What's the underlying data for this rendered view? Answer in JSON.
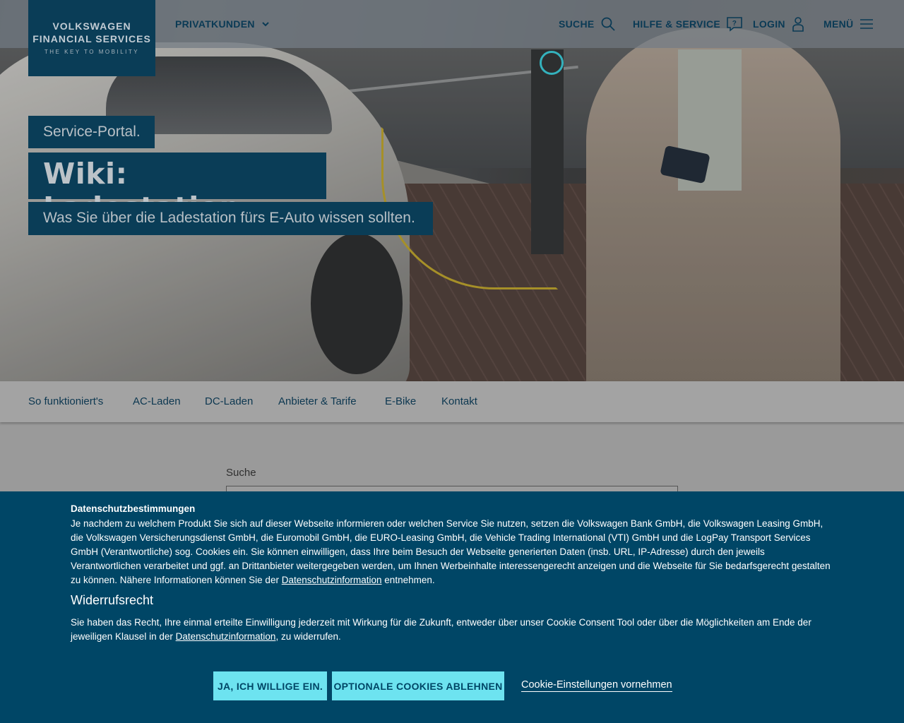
{
  "header": {
    "logo": {
      "line1": "VOLKSWAGEN",
      "line2": "FINANCIAL SERVICES",
      "tagline": "THE KEY TO MOBILITY"
    },
    "segment_label": "PRIVATKUNDEN",
    "search_label": "SUCHE",
    "help_label": "HILFE & SERVICE",
    "login_label": "LOGIN",
    "menu_label": "MENÜ"
  },
  "hero": {
    "kicker": "Service-Portal.",
    "title": "Wiki: Ladestation.",
    "subtitle": "Was Sie über die Ladestation fürs E-Auto wissen sollten."
  },
  "tabs": [
    {
      "label": "So funktioniert's"
    },
    {
      "label": "AC-Laden"
    },
    {
      "label": "DC-Laden"
    },
    {
      "label": "Anbieter & Tarife"
    },
    {
      "label": "E-Bike"
    },
    {
      "label": "Kontakt"
    }
  ],
  "content": {
    "search_label": "Suche",
    "search_value": ""
  },
  "cookie_banner": {
    "title": "Datenschutzbestimmungen",
    "text": "Je nachdem zu welchem Produkt Sie sich auf dieser Webseite informieren oder welchen Service Sie nutzen, setzen die Volkswagen Bank GmbH, die Volkswagen Leasing GmbH, die Volkswagen Versicherungsdienst GmbH, die Euromobil GmbH, die EURO-Leasing GmbH, die Vehicle Trading International (VTI) GmbH und die LogPay Transport Services GmbH (Verantwortliche) sog. Cookies ein. Sie können einwilligen, dass Ihre beim Besuch der Webseite generierten Daten (insb. URL, IP-Adresse) durch den jeweils Verantwortlichen verarbeitet und ggf. an Drittanbieter weitergegeben werden, um Ihnen Werbeinhalte interessengerecht anzeigen und die Webseite für Sie bedarfsgerecht gestalten zu können. Nähere Informationen können Sie der",
    "text_link": "Datenschutzinformation",
    "text_end": " entnehmen.",
    "heading": "Widerrufsrecht",
    "revoke_text": "Sie haben das Recht, Ihre einmal erteilte Einwilligung jederzeit mit Wirkung für die Zukunft, entweder über unser Cookie Consent Tool oder über die Möglichkeiten am Ende der jeweiligen Klausel in der",
    "revoke_link": "Datenschutzinformation",
    "revoke_end": ", zu widerrufen.",
    "accept_label": "JA, ICH WILLIGE EIN.",
    "reject_label": "OPTIONALE COOKIES ABLEHNEN",
    "settings_label": "Cookie-Einstellungen vornehmen"
  },
  "colors": {
    "brand_dark": "#004666",
    "accent_cyan": "#6de3f0",
    "nav_text": "#0a3a55"
  },
  "icons": {
    "segment": "chevron-down-icon",
    "search": "search-icon",
    "help": "help-chat-icon",
    "login": "user-icon",
    "menu": "hamburger-icon"
  }
}
